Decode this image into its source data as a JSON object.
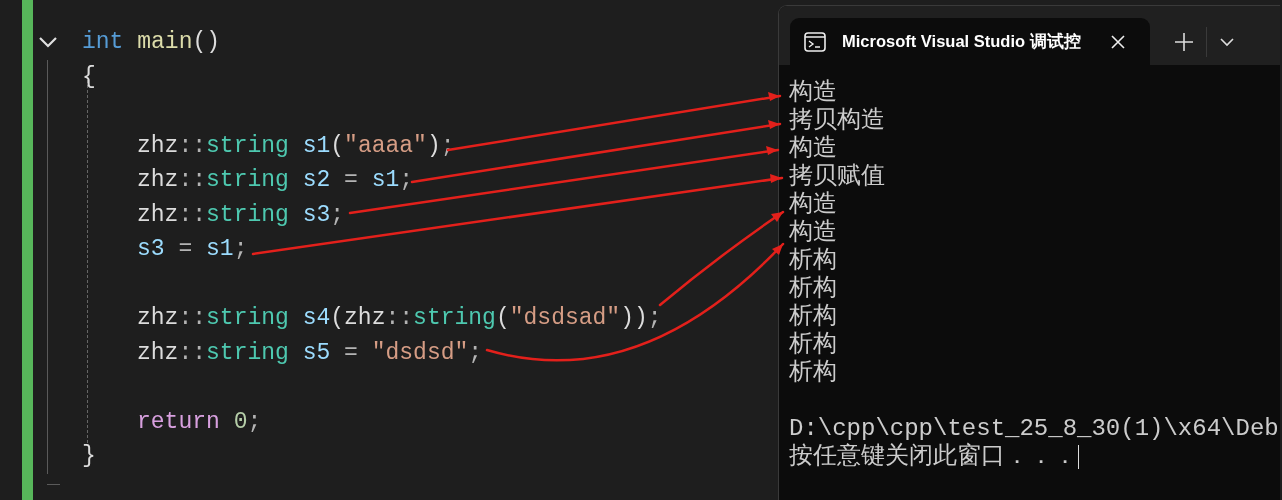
{
  "editor": {
    "fold_expanded": true,
    "signature": [
      {
        "text": "int ",
        "kind": "keyword"
      },
      {
        "text": "main",
        "kind": "function"
      },
      {
        "text": "()",
        "kind": "plain"
      }
    ],
    "open_brace": "{",
    "body": [
      {
        "gap_before": true,
        "tokens": [
          {
            "text": "zhz",
            "kind": "plain"
          },
          {
            "text": "::",
            "kind": "punct"
          },
          {
            "text": "string ",
            "kind": "type"
          },
          {
            "text": "s1",
            "kind": "variable"
          },
          {
            "text": "(",
            "kind": "plain"
          },
          {
            "text": "\"aaaa\"",
            "kind": "string"
          },
          {
            "text": ")",
            "kind": "plain"
          },
          {
            "text": ";",
            "kind": "punct"
          }
        ]
      },
      {
        "gap_before": false,
        "tokens": [
          {
            "text": "zhz",
            "kind": "plain"
          },
          {
            "text": "::",
            "kind": "punct"
          },
          {
            "text": "string ",
            "kind": "type"
          },
          {
            "text": "s2",
            "kind": "variable"
          },
          {
            "text": " = ",
            "kind": "punct"
          },
          {
            "text": "s1",
            "kind": "variable"
          },
          {
            "text": ";",
            "kind": "punct"
          }
        ]
      },
      {
        "gap_before": false,
        "tokens": [
          {
            "text": "zhz",
            "kind": "plain"
          },
          {
            "text": "::",
            "kind": "punct"
          },
          {
            "text": "string ",
            "kind": "type"
          },
          {
            "text": "s3",
            "kind": "variable"
          },
          {
            "text": ";",
            "kind": "punct"
          }
        ]
      },
      {
        "gap_before": false,
        "tokens": [
          {
            "text": "s3",
            "kind": "variable"
          },
          {
            "text": " = ",
            "kind": "punct"
          },
          {
            "text": "s1",
            "kind": "variable"
          },
          {
            "text": ";",
            "kind": "punct"
          }
        ]
      },
      {
        "gap_before": true,
        "tokens": [
          {
            "text": "zhz",
            "kind": "plain"
          },
          {
            "text": "::",
            "kind": "punct"
          },
          {
            "text": "string ",
            "kind": "type"
          },
          {
            "text": "s4",
            "kind": "variable"
          },
          {
            "text": "(zhz",
            "kind": "plain"
          },
          {
            "text": "::",
            "kind": "punct"
          },
          {
            "text": "string",
            "kind": "type"
          },
          {
            "text": "(",
            "kind": "plain"
          },
          {
            "text": "\"dsdsad\"",
            "kind": "string"
          },
          {
            "text": "))",
            "kind": "plain"
          },
          {
            "text": ";",
            "kind": "punct"
          }
        ]
      },
      {
        "gap_before": false,
        "tokens": [
          {
            "text": "zhz",
            "kind": "plain"
          },
          {
            "text": "::",
            "kind": "punct"
          },
          {
            "text": "string ",
            "kind": "type"
          },
          {
            "text": "s5",
            "kind": "variable"
          },
          {
            "text": " = ",
            "kind": "punct"
          },
          {
            "text": "\"dsdsd\"",
            "kind": "string"
          },
          {
            "text": ";",
            "kind": "punct"
          }
        ]
      },
      {
        "gap_before": true,
        "tokens": [
          {
            "text": "return ",
            "kind": "control"
          },
          {
            "text": "0",
            "kind": "number"
          },
          {
            "text": ";",
            "kind": "punct"
          }
        ]
      }
    ],
    "close_brace": "}"
  },
  "terminal": {
    "tab": {
      "title": "Microsoft Visual Studio 调试控",
      "selected": true
    },
    "output": [
      "构造",
      "拷贝构造",
      "构造",
      "拷贝赋值",
      "构造",
      "构造",
      "析构",
      "析构",
      "析构",
      "析构",
      "析构"
    ],
    "path_line": "D:\\cpp\\cpp\\test_25_8_30(1)\\x64\\Deb",
    "prompt_line": "按任意键关闭此窗口．．．"
  }
}
